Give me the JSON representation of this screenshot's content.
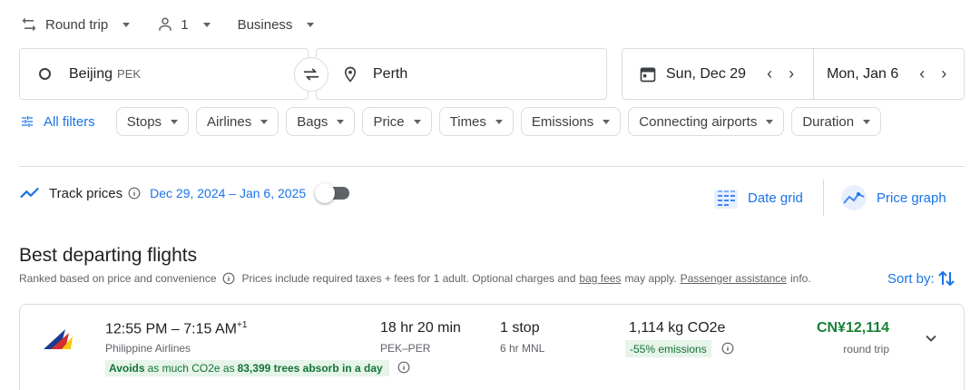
{
  "top": {
    "trip_type": "Round trip",
    "passengers": "1",
    "cabin": "Business"
  },
  "search": {
    "origin_city": "Beijing",
    "origin_code": "PEK",
    "destination": "Perth",
    "depart_date": "Sun, Dec 29",
    "return_date": "Mon, Jan 6"
  },
  "filters": {
    "all_filters": "All filters",
    "chips": [
      "Stops",
      "Airlines",
      "Bags",
      "Price",
      "Times",
      "Emissions",
      "Connecting airports",
      "Duration"
    ]
  },
  "track": {
    "label": "Track prices",
    "range": "Dec 29, 2024 – Jan 6, 2025",
    "enabled": false,
    "date_grid": "Date grid",
    "price_graph": "Price graph"
  },
  "results": {
    "heading": "Best departing flights",
    "ranked_text": "Ranked based on price and convenience",
    "prices_text_1": "Prices include required taxes + fees for 1 adult. Optional charges and",
    "bag_fees": "bag fees",
    "prices_text_2": "may apply.",
    "passenger_assistance": "Passenger assistance",
    "prices_text_3": "info.",
    "sort_by": "Sort by:"
  },
  "flight": {
    "times": "12:55 PM – 7:15 AM",
    "day_offset": "+1",
    "airline": "Philippine Airlines",
    "eco_prefix": "Avoids",
    "eco_mid_1": "as much CO2e as",
    "eco_trees": "83,399 trees absorb in a day",
    "duration": "18 hr 20 min",
    "route": "PEK–PER",
    "stops": "1 stop",
    "layover": "6 hr MNL",
    "co2": "1,114 kg CO2e",
    "emissions_delta": "-55% emissions",
    "price": "CN¥12,114",
    "price_type": "round trip"
  },
  "colors": {
    "accent": "#1a73e8",
    "green": "#188038",
    "green_bg": "#e6f4ea"
  }
}
